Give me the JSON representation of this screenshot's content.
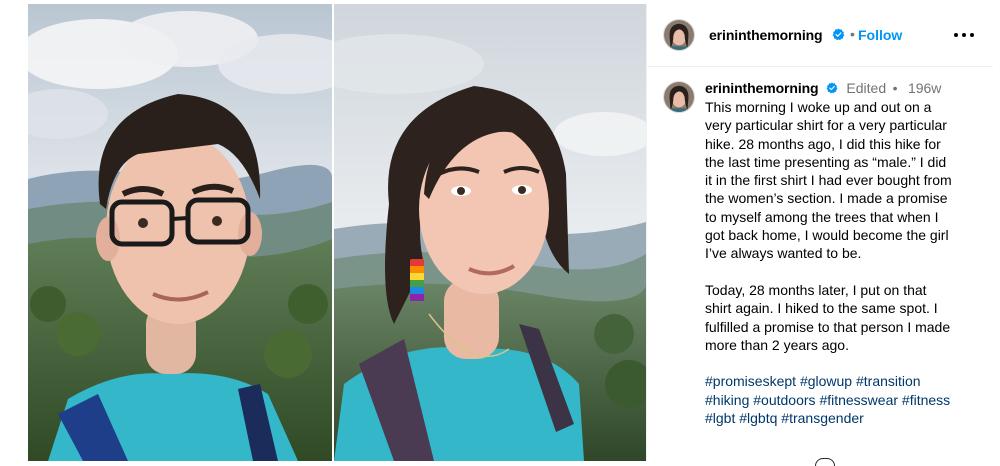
{
  "post": {
    "username": "erininthemorning",
    "follow_label": "Follow",
    "header_separator": "•",
    "more_label": "More options"
  },
  "caption": {
    "username": "erininthemorning",
    "edited": "Edited",
    "separator": "•",
    "time": "196w",
    "paragraph1_lines": [
      "This morning I woke up and out on a",
      "very particular shirt for a very particular",
      "hike. 28 months ago, I did this hike for",
      "the last time presenting as “male.” I did",
      "it in the first shirt I had ever bought from",
      "the women’s section. I made a promise",
      "to myself among the trees that when I",
      "got back home, I would become the girl",
      "I’ve always wanted to be."
    ],
    "paragraph2_lines": [
      "Today, 28 months later, I put on that",
      "shirt again. I hiked to the same spot. I",
      "fulfilled a promise to that person I made",
      "more than 2 years ago."
    ],
    "hashtag_lines": [
      [
        "#promiseskept",
        "#glowup",
        "#transition"
      ],
      [
        "#hiking",
        "#outdoors",
        "#fitnesswear",
        "#fitness"
      ],
      [
        "#lgbt",
        "#lgbtq",
        "#transgender"
      ]
    ]
  },
  "icons": {
    "verified": "verified-badge-icon",
    "more": "more-horizontal-icon"
  },
  "colors": {
    "follow_blue": "#0095f6",
    "verified_blue": "#0095f6",
    "hashtag": "#00376b",
    "muted": "#737373"
  }
}
